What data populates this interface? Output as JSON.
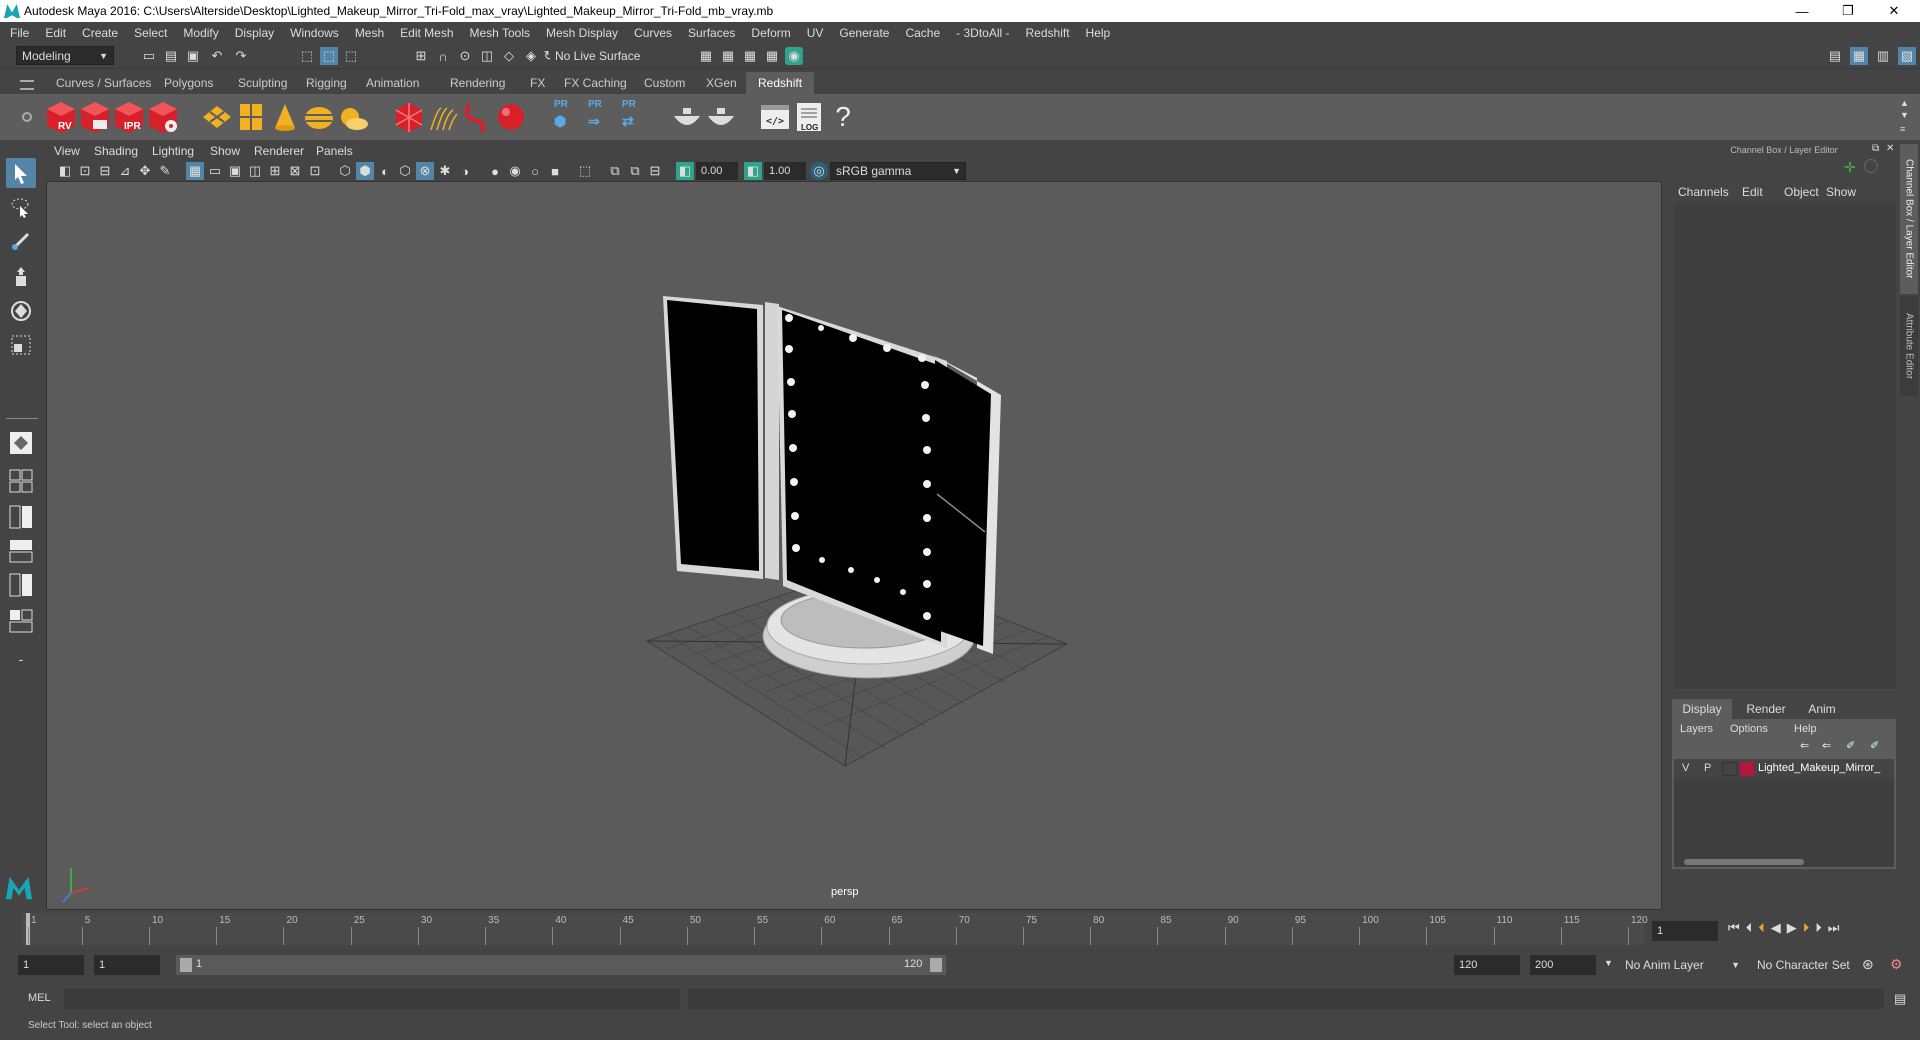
{
  "window": {
    "title": "Autodesk Maya 2016: C:\\Users\\Alterside\\Desktop\\Lighted_Makeup_Mirror_Tri-Fold_max_vray\\Lighted_Makeup_Mirror_Tri-Fold_mb_vray.mb",
    "minimize": "—",
    "restore": "❐",
    "close": "✕"
  },
  "menubar": [
    "File",
    "Edit",
    "Create",
    "Select",
    "Modify",
    "Display",
    "Windows",
    "Mesh",
    "Edit Mesh",
    "Mesh Tools",
    "Mesh Display",
    "Curves",
    "Surfaces",
    "Deform",
    "UV",
    "Generate",
    "Cache",
    "- 3DtoAll -",
    "Redshift",
    "Help"
  ],
  "statusline": {
    "mode": "Modeling",
    "live_surface": "No Live Surface"
  },
  "shelf": {
    "tabs": [
      "Curves / Surfaces",
      "Polygons",
      "Sculpting",
      "Rigging",
      "Animation",
      "Rendering",
      "FX",
      "FX Caching",
      "Custom",
      "XGen",
      "Redshift"
    ],
    "active_tab": "Redshift",
    "icons": [
      {
        "name": "rv-icon",
        "label": "RV"
      },
      {
        "name": "render-icon",
        "label": ""
      },
      {
        "name": "ipr-icon",
        "label": "IPR"
      },
      {
        "name": "render-settings-icon",
        "label": ""
      },
      {
        "name": "pr-label-1",
        "label": "PR"
      },
      {
        "name": "pr-label-2",
        "label": "PR"
      },
      {
        "name": "pr-label-3",
        "label": "PR"
      },
      {
        "name": "log-label",
        "label": "LOG"
      },
      {
        "name": "help-label",
        "label": "?"
      }
    ]
  },
  "panel": {
    "menus": [
      "View",
      "Shading",
      "Lighting",
      "Show",
      "Renderer",
      "Panels"
    ],
    "exposure": "0.00",
    "gamma": "1.00",
    "color_space": "sRGB gamma",
    "camera_label": "persp"
  },
  "channel_box": {
    "title": "Channel Box / Layer Editor",
    "menus": [
      "Channels",
      "Edit",
      "Object",
      "Show"
    ],
    "layer_tabs": [
      "Display",
      "Render",
      "Anim"
    ],
    "active_layer_tab": "Display",
    "layer_menus": [
      "Layers",
      "Options",
      "Help"
    ],
    "layer": {
      "v": "V",
      "p": "P",
      "name": "Lighted_Makeup_Mirror_",
      "color": "#b0193a"
    },
    "side_tabs": [
      "Channel Box / Layer Editor",
      "Attribute Editor"
    ]
  },
  "timeline": {
    "ticks": [
      "1",
      "5",
      "10",
      "15",
      "20",
      "25",
      "30",
      "35",
      "40",
      "45",
      "50",
      "55",
      "60",
      "65",
      "70",
      "75",
      "80",
      "85",
      "90",
      "95",
      "100",
      "105",
      "110",
      "115",
      "120"
    ],
    "current_frame": "1"
  },
  "range": {
    "start": "1",
    "playback_start": "1",
    "slider_start": "1",
    "slider_end": "120",
    "playback_end": "120",
    "end": "200",
    "anim_layer": "No Anim Layer",
    "character_set": "No Character Set"
  },
  "cmdline": {
    "label": "MEL"
  },
  "helpline": {
    "text": "Select Tool: select an object"
  }
}
